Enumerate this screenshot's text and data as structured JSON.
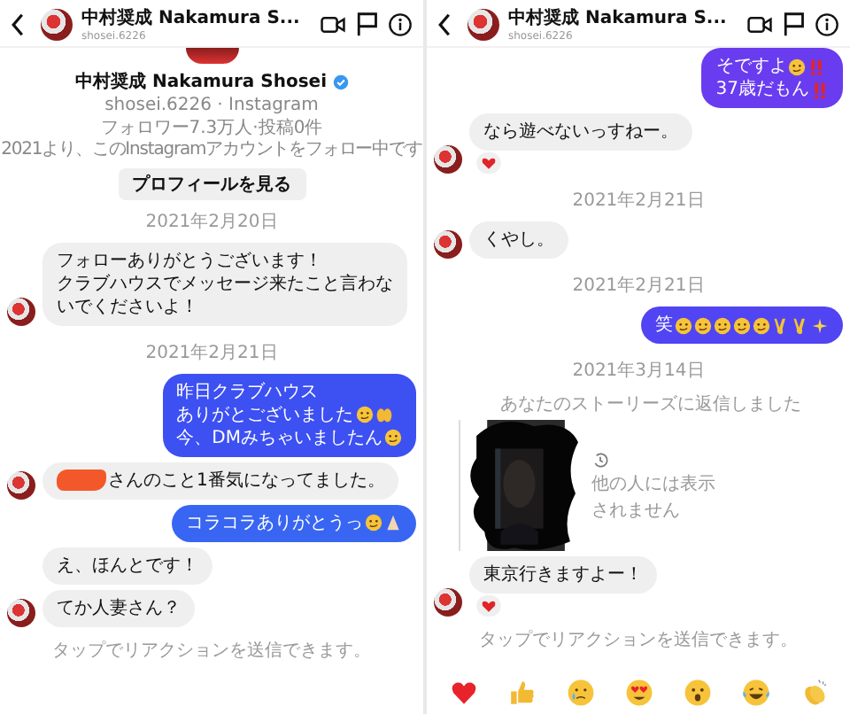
{
  "panels": [
    {
      "header": {
        "name": "中村奨成 Nakamura S...",
        "username": "shosei.6226"
      },
      "profile": {
        "name": "中村奨成 Nakamura Shosei",
        "verified": true,
        "subtitle": "shosei.6226 · Instagram",
        "stats": "フォロワー7.3万人·投稿0件",
        "following_note": "2021より、このInstagramアカウントをフォロー中です",
        "button": "プロフィールを見る"
      },
      "messages": [
        {
          "kind": "date",
          "text": "2021年2月20日"
        },
        {
          "kind": "in",
          "avatar": true,
          "lines": [
            {
              "text": "フォローありがとうございます！"
            },
            {
              "text": "クラブハウスでメッセージ来たこと言わな"
            },
            {
              "text": "いでくださいよ！"
            }
          ]
        },
        {
          "kind": "date",
          "text": "2021年2月21日"
        },
        {
          "kind": "out",
          "color": "#3d50f2",
          "lines": [
            {
              "text": "昨日クラブハウス"
            },
            {
              "text": "ありがとございました",
              "icons": [
                {
                  "kind": "face"
                },
                {
                  "kind": "hands"
                }
              ]
            },
            {
              "text": "今、DMみちゃいましたん",
              "icons": [
                {
                  "kind": "face"
                }
              ]
            }
          ]
        },
        {
          "kind": "in",
          "avatar": true,
          "redacted": true,
          "lines": [
            {
              "text": "さんのこと1番気になってました。"
            }
          ]
        },
        {
          "kind": "out",
          "color": "#3866f2",
          "lines": [
            {
              "text": "コラコラありがとうっ",
              "icons": [
                {
                  "kind": "face"
                },
                {
                  "kind": "pray"
                }
              ]
            }
          ]
        },
        {
          "kind": "in",
          "avatar": false,
          "lines": [
            {
              "text": "え、ほんとです！"
            }
          ]
        },
        {
          "kind": "in",
          "avatar": true,
          "lines": [
            {
              "text": "てか人妻さん？"
            }
          ]
        },
        {
          "kind": "notice",
          "text": "タップでリアクションを送信できます。"
        }
      ]
    },
    {
      "header": {
        "name": "中村奨成 Nakamura S...",
        "username": "shosei.6226"
      },
      "messages": [
        {
          "kind": "out",
          "color": "#6a3cf0",
          "lines": [
            {
              "text": "そですよ",
              "icons": [
                {
                  "kind": "face"
                },
                {
                  "kind": "bang"
                }
              ]
            },
            {
              "text": "37歳だもん",
              "icons": [
                {
                  "kind": "bang"
                }
              ]
            }
          ]
        },
        {
          "kind": "in",
          "avatar": true,
          "reaction": true,
          "lines": [
            {
              "text": "なら遊べないっすねー。"
            }
          ]
        },
        {
          "kind": "date",
          "text": "2021年2月21日"
        },
        {
          "kind": "in",
          "avatar": true,
          "lines": [
            {
              "text": "くやし。"
            }
          ]
        },
        {
          "kind": "date",
          "text": "2021年2月21日"
        },
        {
          "kind": "out",
          "color": "#5144f2",
          "lines": [
            {
              "text": "笑",
              "icons": [
                {
                  "kind": "face"
                },
                {
                  "kind": "face"
                },
                {
                  "kind": "face"
                },
                {
                  "kind": "face"
                },
                {
                  "kind": "face"
                },
                {
                  "kind": "peace"
                },
                {
                  "kind": "peace"
                },
                {
                  "kind": "sparkle"
                }
              ]
            }
          ]
        },
        {
          "kind": "date",
          "text": "2021年3月14日"
        },
        {
          "kind": "story",
          "label": "あなたのストーリーズに返信しました",
          "caption_lines": [
            "他の人には表示",
            "されません"
          ]
        },
        {
          "kind": "in",
          "avatar": true,
          "reaction": true,
          "lines": [
            {
              "text": "東京行きますよー！"
            }
          ]
        },
        {
          "kind": "notice",
          "text": "タップでリアクションを送信できます。"
        }
      ],
      "reactions": [
        {
          "kind": "heart"
        },
        {
          "kind": "thumbs"
        },
        {
          "kind": "cry"
        },
        {
          "kind": "hearteyes"
        },
        {
          "kind": "wow"
        },
        {
          "kind": "laugh"
        },
        {
          "kind": "clap"
        }
      ]
    }
  ]
}
